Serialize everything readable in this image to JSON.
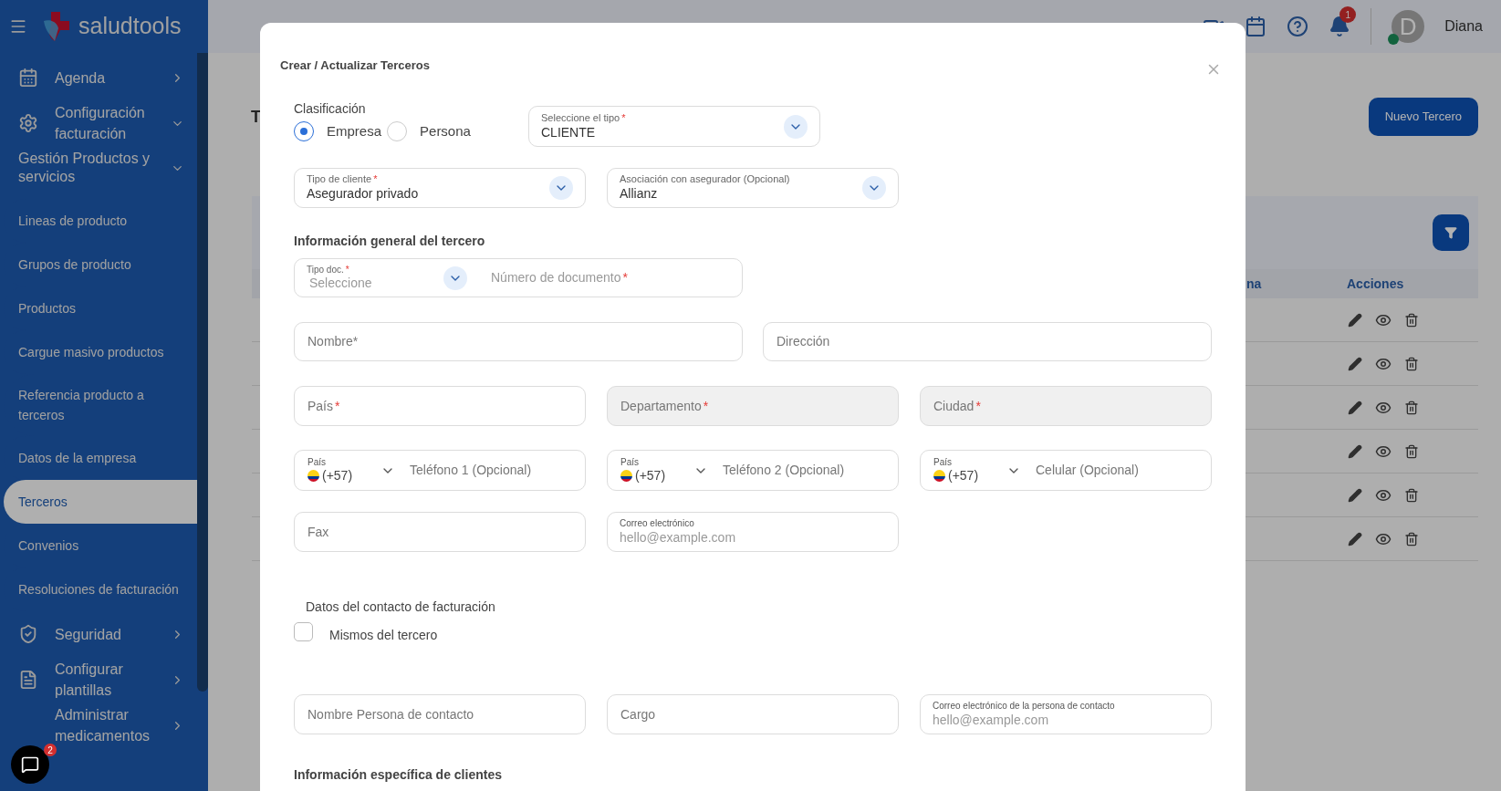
{
  "sidebar": {
    "brand": "saludtools",
    "items": [
      {
        "kind": "group",
        "label": "Agenda",
        "expanded": false
      },
      {
        "kind": "group",
        "label": "Configuración facturación",
        "expanded": true
      },
      {
        "kind": "subgroup",
        "label": "Gestión Productos y servicios",
        "expanded": true
      },
      {
        "kind": "link",
        "label": "Lineas de producto",
        "selected": false
      },
      {
        "kind": "link",
        "label": "Grupos de producto",
        "selected": false
      },
      {
        "kind": "link",
        "label": "Productos",
        "selected": false
      },
      {
        "kind": "link",
        "label": "Cargue masivo productos",
        "selected": false
      },
      {
        "kind": "link",
        "label": "Referencia producto a terceros",
        "selected": false
      },
      {
        "kind": "link",
        "label": "Datos de la empresa",
        "selected": false
      },
      {
        "kind": "link",
        "label": "Terceros",
        "selected": true
      },
      {
        "kind": "link",
        "label": "Convenios",
        "selected": false
      },
      {
        "kind": "link",
        "label": "Resoluciones de facturación",
        "selected": false
      },
      {
        "kind": "group",
        "label": "Seguridad",
        "expanded": false
      },
      {
        "kind": "group",
        "label": "Configurar plantillas",
        "expanded": false
      },
      {
        "kind": "group",
        "label": "Administrar medicamentos",
        "expanded": false
      }
    ]
  },
  "header": {
    "notifications": "1",
    "avatar": "D",
    "user": "Diana"
  },
  "page": {
    "title": "T",
    "new_button": "Nuevo Tercero",
    "table": {
      "columns": [
        "na",
        "Acciones"
      ]
    }
  },
  "chat": {
    "badge": "2"
  },
  "modal": {
    "title": "Crear / Actualizar Terceros",
    "classification": {
      "label": "Clasificación",
      "options": [
        {
          "label": "Empresa",
          "selected": true
        },
        {
          "label": "Persona",
          "selected": false
        }
      ]
    },
    "type_select": {
      "kind": "select",
      "label": "Seleccione el tipo",
      "mark": "*",
      "value": "CLIENTE"
    },
    "client_row": [
      {
        "kind": "select",
        "label": "Tipo de cliente",
        "mark": "*",
        "value": "Asegurador privado"
      },
      {
        "kind": "select",
        "label": "Asociación con asegurador (Opcional)",
        "value": "Allianz"
      }
    ],
    "general_title": "Información general del tercero",
    "document": {
      "type_label": "Tipo doc.",
      "type_mark": "*",
      "type_value": "Seleccione",
      "placeholder": "Número de documento",
      "mark": "*"
    },
    "name_row": [
      {
        "kind": "text",
        "placeholder": "Nombre*"
      },
      {
        "kind": "text",
        "placeholder": "Dirección"
      }
    ],
    "location_row": [
      {
        "kind": "text",
        "placeholder": "País",
        "mark": "*",
        "disabled": false
      },
      {
        "kind": "text",
        "placeholder": "Departamento",
        "mark": "*",
        "disabled": true
      },
      {
        "kind": "text",
        "placeholder": "Ciudad",
        "mark": "*",
        "disabled": true
      }
    ],
    "phone_row": [
      {
        "kind": "phone",
        "label": "País",
        "code": "(+57)",
        "placeholder": "Teléfono 1 (Opcional)"
      },
      {
        "kind": "phone",
        "label": "País",
        "code": "(+57)",
        "placeholder": "Teléfono 2 (Opcional)"
      },
      {
        "kind": "phone",
        "label": "País",
        "code": "(+57)",
        "placeholder": "Celular (Opcional)"
      }
    ],
    "contact_row": [
      {
        "kind": "text",
        "placeholder": "Fax"
      },
      {
        "kind": "floating",
        "label": "Correo electrónico",
        "placeholder": "hello@example.com"
      }
    ],
    "billing": {
      "title": "Datos del contacto de facturación",
      "same": {
        "label": "Mismos del tercero",
        "checked": false
      }
    },
    "billing_row": [
      {
        "kind": "text",
        "placeholder": "Nombre Persona de contacto"
      },
      {
        "kind": "text",
        "placeholder": "Cargo"
      },
      {
        "kind": "floating",
        "label": "Correo electrónico de la persona de contacto",
        "placeholder": "hello@example.com"
      }
    ],
    "footer_title": "Información específica de clientes"
  }
}
